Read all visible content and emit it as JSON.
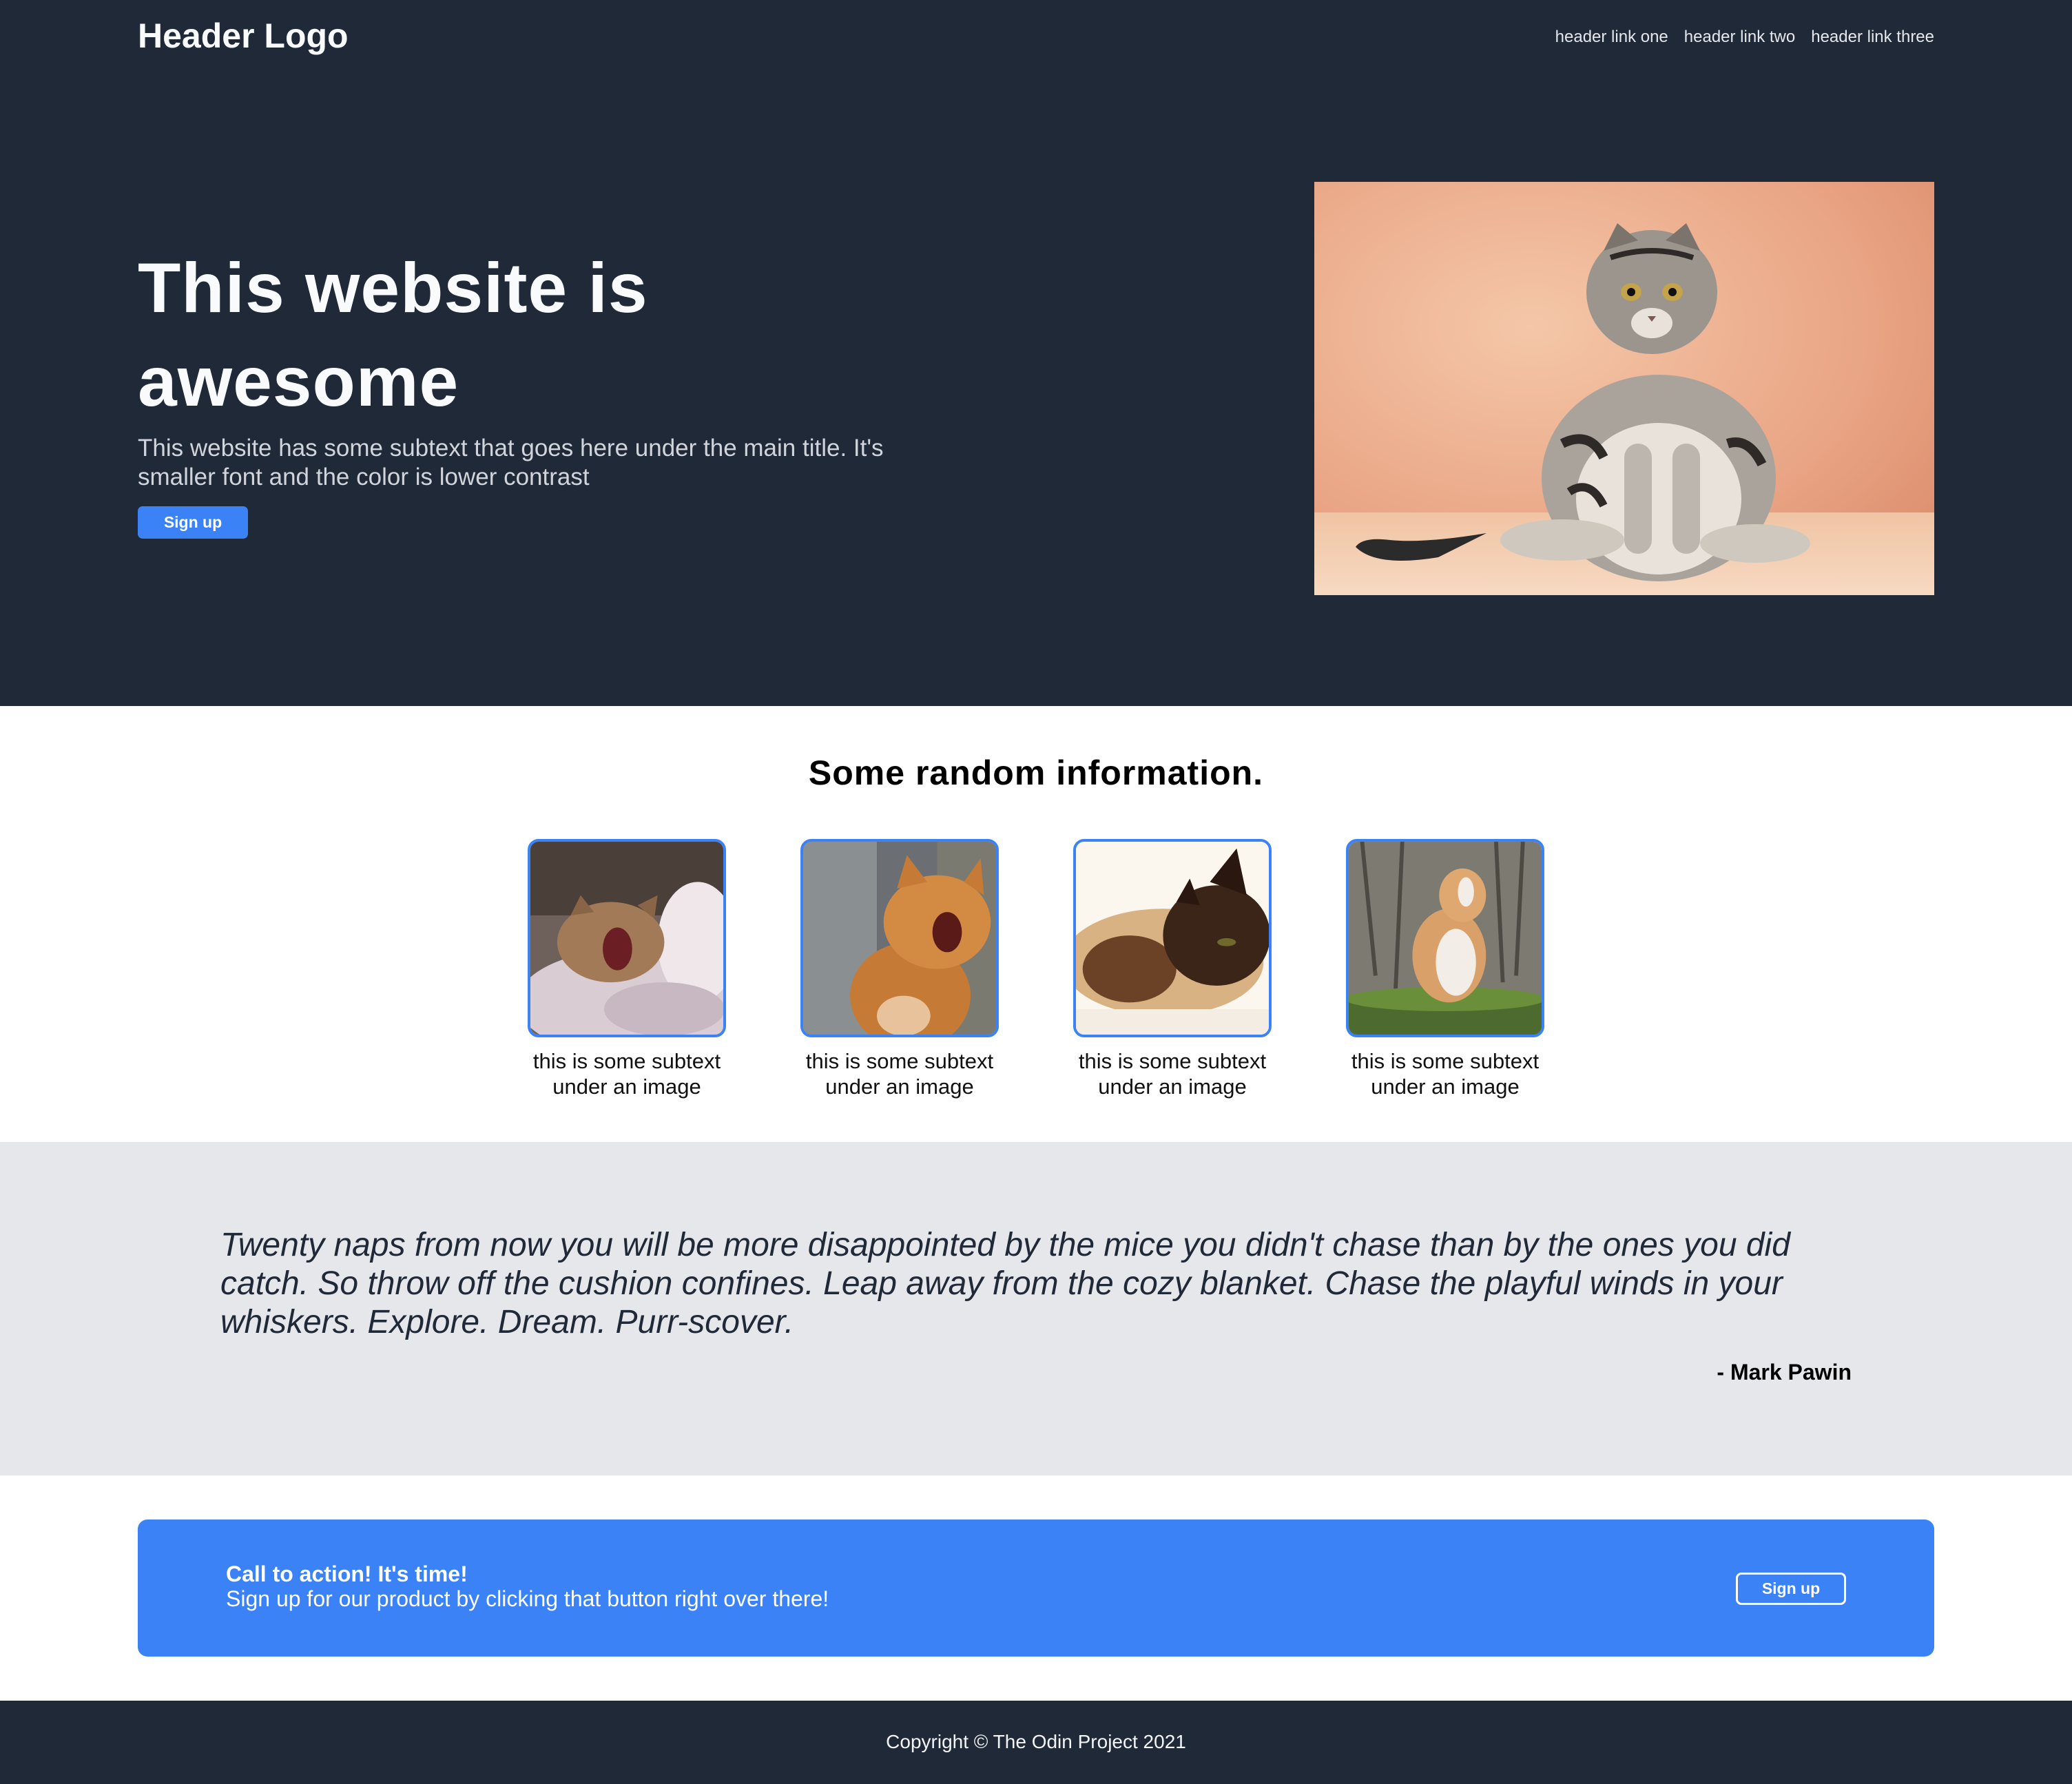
{
  "header": {
    "logo": "Header Logo",
    "links": [
      "header link one",
      "header link two",
      "header link three"
    ]
  },
  "hero": {
    "title": "This website is awesome",
    "subtext": "This website has some subtext that goes here under the main title. It's smaller font and the color is lower contrast",
    "button_label": "Sign up",
    "image": "scottish-fold-cat-photo"
  },
  "info": {
    "title": "Some random information.",
    "cards": [
      {
        "image": "yawning-cat-in-bed-photo",
        "caption": "this is some subtext under an image"
      },
      {
        "image": "yawning-orange-cat-photo",
        "caption": "this is some subtext under an image"
      },
      {
        "image": "sleeping-siamese-cat-photo",
        "caption": "this is some subtext under an image"
      },
      {
        "image": "cat-on-log-photo",
        "caption": "this is some subtext under an image"
      }
    ]
  },
  "quote": {
    "text": "Twenty naps from now you will be more disappointed by the mice you didn't chase than by the ones you did catch. So throw off the cushion confines. Leap away from the cozy blanket. Chase the playful winds in your whiskers. Explore. Dream. Purr-scover.",
    "author": "- Mark Pawin"
  },
  "cta": {
    "title": "Call to action! It's time!",
    "text": "Sign up for our product by clicking that button right over there!",
    "button_label": "Sign up"
  },
  "footer": {
    "copyright": "Copyright © The Odin Project 2021"
  },
  "colors": {
    "dark": "#1f2937",
    "accent": "#3b82f6",
    "quote_bg": "#e5e7eb"
  }
}
